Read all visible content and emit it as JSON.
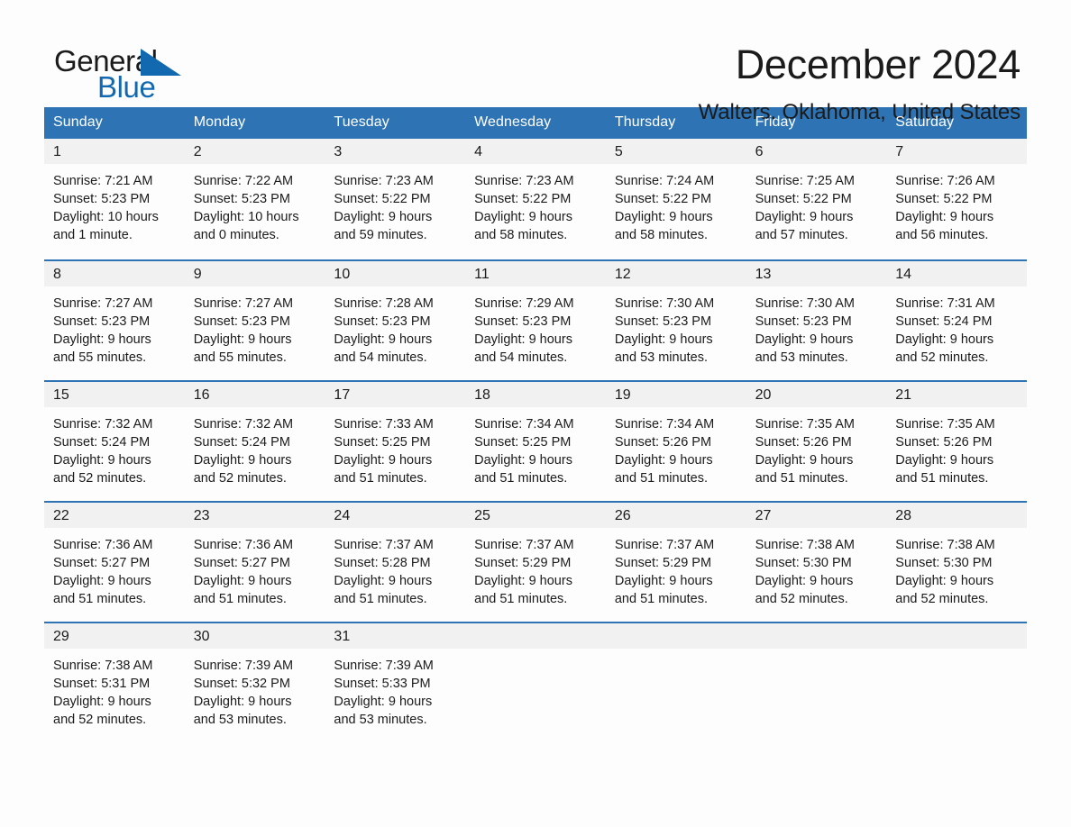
{
  "brand": {
    "name_part1": "General",
    "name_part2": "Blue",
    "logo_icon": "blue-triangle-icon",
    "accent_color": "#1269b0"
  },
  "header": {
    "title": "December 2024",
    "location": "Walters, Oklahoma, United States"
  },
  "calendar": {
    "header_bg": "#2e74b5",
    "daynum_bg": "#f1f1f1",
    "weekdays": [
      "Sunday",
      "Monday",
      "Tuesday",
      "Wednesday",
      "Thursday",
      "Friday",
      "Saturday"
    ],
    "weeks": [
      [
        {
          "day": "1",
          "sunrise": "Sunrise: 7:21 AM",
          "sunset": "Sunset: 5:23 PM",
          "daylight_line1": "Daylight: 10 hours",
          "daylight_line2": "and 1 minute."
        },
        {
          "day": "2",
          "sunrise": "Sunrise: 7:22 AM",
          "sunset": "Sunset: 5:23 PM",
          "daylight_line1": "Daylight: 10 hours",
          "daylight_line2": "and 0 minutes."
        },
        {
          "day": "3",
          "sunrise": "Sunrise: 7:23 AM",
          "sunset": "Sunset: 5:22 PM",
          "daylight_line1": "Daylight: 9 hours",
          "daylight_line2": "and 59 minutes."
        },
        {
          "day": "4",
          "sunrise": "Sunrise: 7:23 AM",
          "sunset": "Sunset: 5:22 PM",
          "daylight_line1": "Daylight: 9 hours",
          "daylight_line2": "and 58 minutes."
        },
        {
          "day": "5",
          "sunrise": "Sunrise: 7:24 AM",
          "sunset": "Sunset: 5:22 PM",
          "daylight_line1": "Daylight: 9 hours",
          "daylight_line2": "and 58 minutes."
        },
        {
          "day": "6",
          "sunrise": "Sunrise: 7:25 AM",
          "sunset": "Sunset: 5:22 PM",
          "daylight_line1": "Daylight: 9 hours",
          "daylight_line2": "and 57 minutes."
        },
        {
          "day": "7",
          "sunrise": "Sunrise: 7:26 AM",
          "sunset": "Sunset: 5:22 PM",
          "daylight_line1": "Daylight: 9 hours",
          "daylight_line2": "and 56 minutes."
        }
      ],
      [
        {
          "day": "8",
          "sunrise": "Sunrise: 7:27 AM",
          "sunset": "Sunset: 5:23 PM",
          "daylight_line1": "Daylight: 9 hours",
          "daylight_line2": "and 55 minutes."
        },
        {
          "day": "9",
          "sunrise": "Sunrise: 7:27 AM",
          "sunset": "Sunset: 5:23 PM",
          "daylight_line1": "Daylight: 9 hours",
          "daylight_line2": "and 55 minutes."
        },
        {
          "day": "10",
          "sunrise": "Sunrise: 7:28 AM",
          "sunset": "Sunset: 5:23 PM",
          "daylight_line1": "Daylight: 9 hours",
          "daylight_line2": "and 54 minutes."
        },
        {
          "day": "11",
          "sunrise": "Sunrise: 7:29 AM",
          "sunset": "Sunset: 5:23 PM",
          "daylight_line1": "Daylight: 9 hours",
          "daylight_line2": "and 54 minutes."
        },
        {
          "day": "12",
          "sunrise": "Sunrise: 7:30 AM",
          "sunset": "Sunset: 5:23 PM",
          "daylight_line1": "Daylight: 9 hours",
          "daylight_line2": "and 53 minutes."
        },
        {
          "day": "13",
          "sunrise": "Sunrise: 7:30 AM",
          "sunset": "Sunset: 5:23 PM",
          "daylight_line1": "Daylight: 9 hours",
          "daylight_line2": "and 53 minutes."
        },
        {
          "day": "14",
          "sunrise": "Sunrise: 7:31 AM",
          "sunset": "Sunset: 5:24 PM",
          "daylight_line1": "Daylight: 9 hours",
          "daylight_line2": "and 52 minutes."
        }
      ],
      [
        {
          "day": "15",
          "sunrise": "Sunrise: 7:32 AM",
          "sunset": "Sunset: 5:24 PM",
          "daylight_line1": "Daylight: 9 hours",
          "daylight_line2": "and 52 minutes."
        },
        {
          "day": "16",
          "sunrise": "Sunrise: 7:32 AM",
          "sunset": "Sunset: 5:24 PM",
          "daylight_line1": "Daylight: 9 hours",
          "daylight_line2": "and 52 minutes."
        },
        {
          "day": "17",
          "sunrise": "Sunrise: 7:33 AM",
          "sunset": "Sunset: 5:25 PM",
          "daylight_line1": "Daylight: 9 hours",
          "daylight_line2": "and 51 minutes."
        },
        {
          "day": "18",
          "sunrise": "Sunrise: 7:34 AM",
          "sunset": "Sunset: 5:25 PM",
          "daylight_line1": "Daylight: 9 hours",
          "daylight_line2": "and 51 minutes."
        },
        {
          "day": "19",
          "sunrise": "Sunrise: 7:34 AM",
          "sunset": "Sunset: 5:26 PM",
          "daylight_line1": "Daylight: 9 hours",
          "daylight_line2": "and 51 minutes."
        },
        {
          "day": "20",
          "sunrise": "Sunrise: 7:35 AM",
          "sunset": "Sunset: 5:26 PM",
          "daylight_line1": "Daylight: 9 hours",
          "daylight_line2": "and 51 minutes."
        },
        {
          "day": "21",
          "sunrise": "Sunrise: 7:35 AM",
          "sunset": "Sunset: 5:26 PM",
          "daylight_line1": "Daylight: 9 hours",
          "daylight_line2": "and 51 minutes."
        }
      ],
      [
        {
          "day": "22",
          "sunrise": "Sunrise: 7:36 AM",
          "sunset": "Sunset: 5:27 PM",
          "daylight_line1": "Daylight: 9 hours",
          "daylight_line2": "and 51 minutes."
        },
        {
          "day": "23",
          "sunrise": "Sunrise: 7:36 AM",
          "sunset": "Sunset: 5:27 PM",
          "daylight_line1": "Daylight: 9 hours",
          "daylight_line2": "and 51 minutes."
        },
        {
          "day": "24",
          "sunrise": "Sunrise: 7:37 AM",
          "sunset": "Sunset: 5:28 PM",
          "daylight_line1": "Daylight: 9 hours",
          "daylight_line2": "and 51 minutes."
        },
        {
          "day": "25",
          "sunrise": "Sunrise: 7:37 AM",
          "sunset": "Sunset: 5:29 PM",
          "daylight_line1": "Daylight: 9 hours",
          "daylight_line2": "and 51 minutes."
        },
        {
          "day": "26",
          "sunrise": "Sunrise: 7:37 AM",
          "sunset": "Sunset: 5:29 PM",
          "daylight_line1": "Daylight: 9 hours",
          "daylight_line2": "and 51 minutes."
        },
        {
          "day": "27",
          "sunrise": "Sunrise: 7:38 AM",
          "sunset": "Sunset: 5:30 PM",
          "daylight_line1": "Daylight: 9 hours",
          "daylight_line2": "and 52 minutes."
        },
        {
          "day": "28",
          "sunrise": "Sunrise: 7:38 AM",
          "sunset": "Sunset: 5:30 PM",
          "daylight_line1": "Daylight: 9 hours",
          "daylight_line2": "and 52 minutes."
        }
      ],
      [
        {
          "day": "29",
          "sunrise": "Sunrise: 7:38 AM",
          "sunset": "Sunset: 5:31 PM",
          "daylight_line1": "Daylight: 9 hours",
          "daylight_line2": "and 52 minutes."
        },
        {
          "day": "30",
          "sunrise": "Sunrise: 7:39 AM",
          "sunset": "Sunset: 5:32 PM",
          "daylight_line1": "Daylight: 9 hours",
          "daylight_line2": "and 53 minutes."
        },
        {
          "day": "31",
          "sunrise": "Sunrise: 7:39 AM",
          "sunset": "Sunset: 5:33 PM",
          "daylight_line1": "Daylight: 9 hours",
          "daylight_line2": "and 53 minutes."
        },
        {
          "day": "",
          "sunrise": "",
          "sunset": "",
          "daylight_line1": "",
          "daylight_line2": ""
        },
        {
          "day": "",
          "sunrise": "",
          "sunset": "",
          "daylight_line1": "",
          "daylight_line2": ""
        },
        {
          "day": "",
          "sunrise": "",
          "sunset": "",
          "daylight_line1": "",
          "daylight_line2": ""
        },
        {
          "day": "",
          "sunrise": "",
          "sunset": "",
          "daylight_line1": "",
          "daylight_line2": ""
        }
      ]
    ]
  }
}
